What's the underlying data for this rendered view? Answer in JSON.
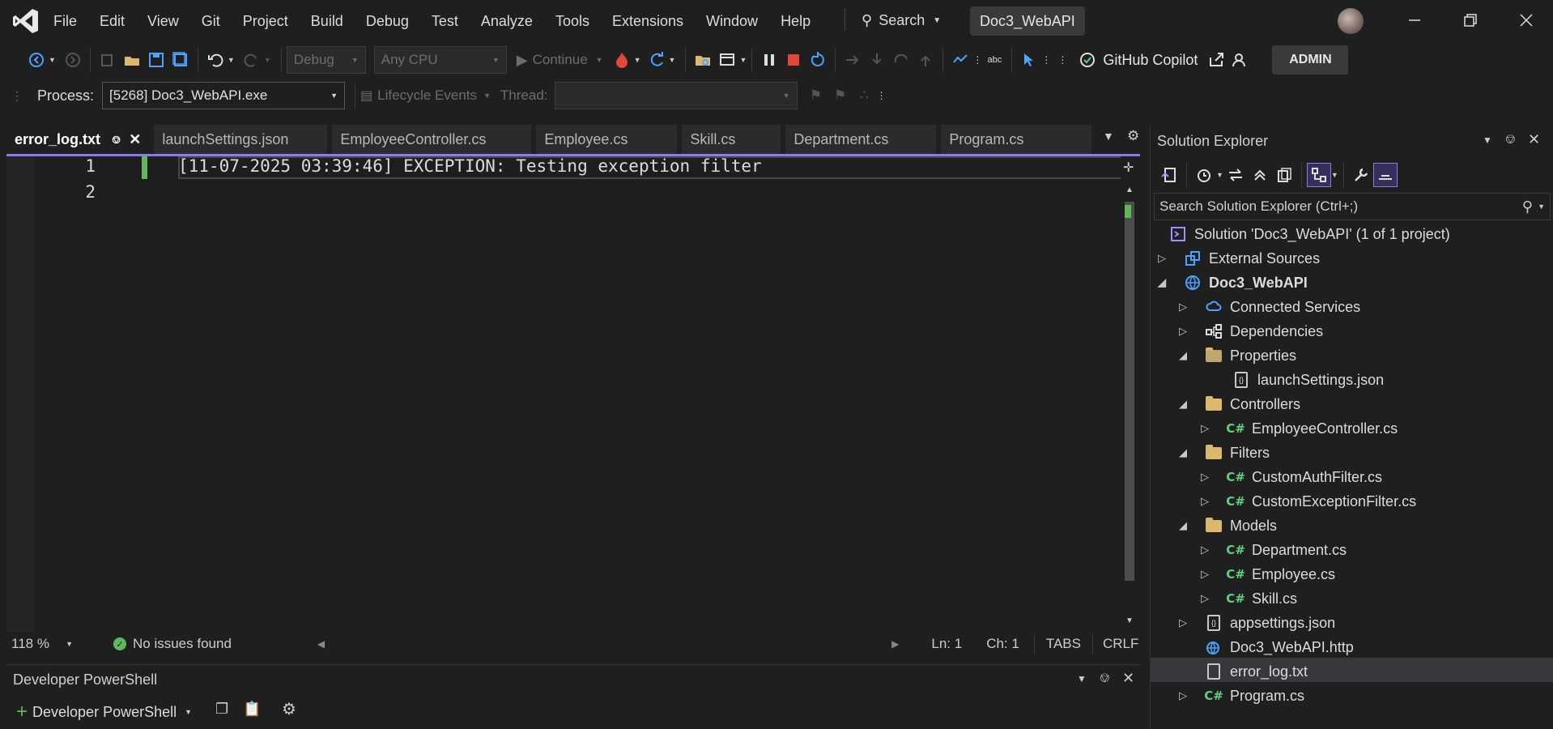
{
  "menu": {
    "items": [
      "File",
      "Edit",
      "View",
      "Git",
      "Project",
      "Build",
      "Debug",
      "Test",
      "Analyze",
      "Tools",
      "Extensions",
      "Window",
      "Help"
    ],
    "search_label": "Search",
    "solution_title": "Doc3_WebAPI"
  },
  "toolbar": {
    "config": "Debug",
    "platform": "Any CPU",
    "continue_label": "Continue",
    "copilot_label": "GitHub Copilot",
    "admin_label": "ADMIN"
  },
  "toolbar2": {
    "process_label": "Process:",
    "process_value": "[5268] Doc3_WebAPI.exe",
    "lifecycle_label": "Lifecycle Events",
    "thread_label": "Thread:"
  },
  "tabs": [
    {
      "label": "error_log.txt"
    },
    {
      "label": "launchSettings.json"
    },
    {
      "label": "EmployeeController.cs"
    },
    {
      "label": "Employee.cs"
    },
    {
      "label": "Skill.cs"
    },
    {
      "label": "Department.cs"
    },
    {
      "label": "Program.cs"
    }
  ],
  "editor": {
    "lines": [
      {
        "no": "1",
        "text": "[11-07-2025 03:39:46] EXCEPTION: Testing exception filter"
      },
      {
        "no": "2",
        "text": ""
      }
    ]
  },
  "status": {
    "zoom": "118 %",
    "issues": "No issues found",
    "ln": "Ln: 1",
    "ch": "Ch: 1",
    "tabs": "TABS",
    "eol": "CRLF"
  },
  "terminal": {
    "title": "Developer PowerShell",
    "new_label": "Developer PowerShell"
  },
  "solution_explorer": {
    "title": "Solution Explorer",
    "search_placeholder": "Search Solution Explorer (Ctrl+;)",
    "items": [
      {
        "label": "Solution 'Doc3_WebAPI' (1 of 1 project)",
        "icon": "solution-icon"
      },
      {
        "label": "External Sources",
        "icon": "external-sources-icon"
      },
      {
        "label": "Doc3_WebAPI",
        "icon": "web-project-icon"
      },
      {
        "label": "Connected Services",
        "icon": "connected-services-icon"
      },
      {
        "label": "Dependencies",
        "icon": "dependencies-icon"
      },
      {
        "label": "Properties",
        "icon": "properties-icon"
      },
      {
        "label": "launchSettings.json",
        "icon": "json-icon"
      },
      {
        "label": "Controllers",
        "icon": "folder-icon"
      },
      {
        "label": "EmployeeController.cs",
        "icon": "csharp-icon"
      },
      {
        "label": "Filters",
        "icon": "folder-icon"
      },
      {
        "label": "CustomAuthFilter.cs",
        "icon": "csharp-icon"
      },
      {
        "label": "CustomExceptionFilter.cs",
        "icon": "csharp-icon"
      },
      {
        "label": "Models",
        "icon": "folder-icon"
      },
      {
        "label": "Department.cs",
        "icon": "csharp-icon"
      },
      {
        "label": "Employee.cs",
        "icon": "csharp-icon"
      },
      {
        "label": "Skill.cs",
        "icon": "csharp-icon"
      },
      {
        "label": "appsettings.json",
        "icon": "json-icon"
      },
      {
        "label": "Doc3_WebAPI.http",
        "icon": "http-icon"
      },
      {
        "label": "error_log.txt",
        "icon": "text-file-icon"
      },
      {
        "label": "Program.cs",
        "icon": "csharp-icon"
      }
    ]
  },
  "colors": {
    "accent": "#8c7ae6",
    "green": "#5fd07b",
    "folder": "#dcb86d",
    "background": "#1f1f1f"
  }
}
